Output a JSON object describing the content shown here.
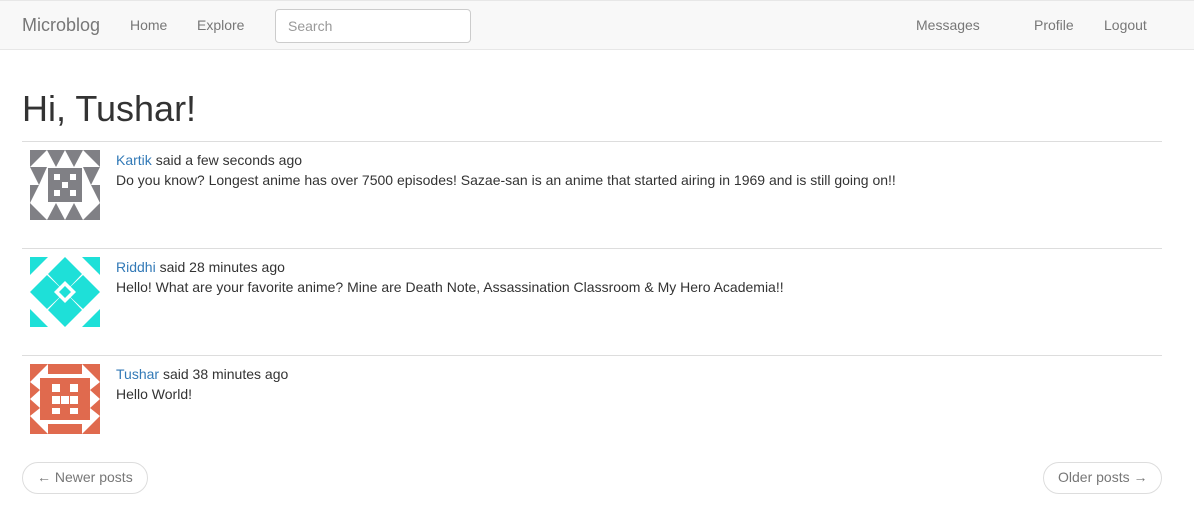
{
  "navbar": {
    "brand": "Microblog",
    "home": "Home",
    "explore": "Explore",
    "search_placeholder": "Search",
    "messages": "Messages",
    "profile": "Profile",
    "logout": "Logout"
  },
  "main": {
    "greeting": "Hi, Tushar!",
    "posts": [
      {
        "author": "Kartik",
        "said": "said",
        "time": "a few seconds ago",
        "body": "Do you know? Longest anime has over 7500 episodes! Sazae-san is an anime that started airing in 1969 and is still going on!!",
        "avatar_color": "#808085",
        "avatar_icon": "identicon"
      },
      {
        "author": "Riddhi",
        "said": "said",
        "time": "28 minutes ago",
        "body": "Hello! What are your favorite anime? Mine are Death Note, Assassination Classroom & My Hero Academia!!",
        "avatar_color": "#1ee0d8",
        "avatar_icon": "identicon"
      },
      {
        "author": "Tushar",
        "said": "said",
        "time": "38 minutes ago",
        "body": "Hello World!",
        "avatar_color": "#e06a4e",
        "avatar_icon": "identicon"
      }
    ],
    "pager": {
      "newer": "← Newer posts",
      "older": "Older posts →"
    }
  },
  "colors": {
    "link": "#337ab7",
    "navbar_bg": "#f8f8f8",
    "nav_text": "#777777"
  }
}
